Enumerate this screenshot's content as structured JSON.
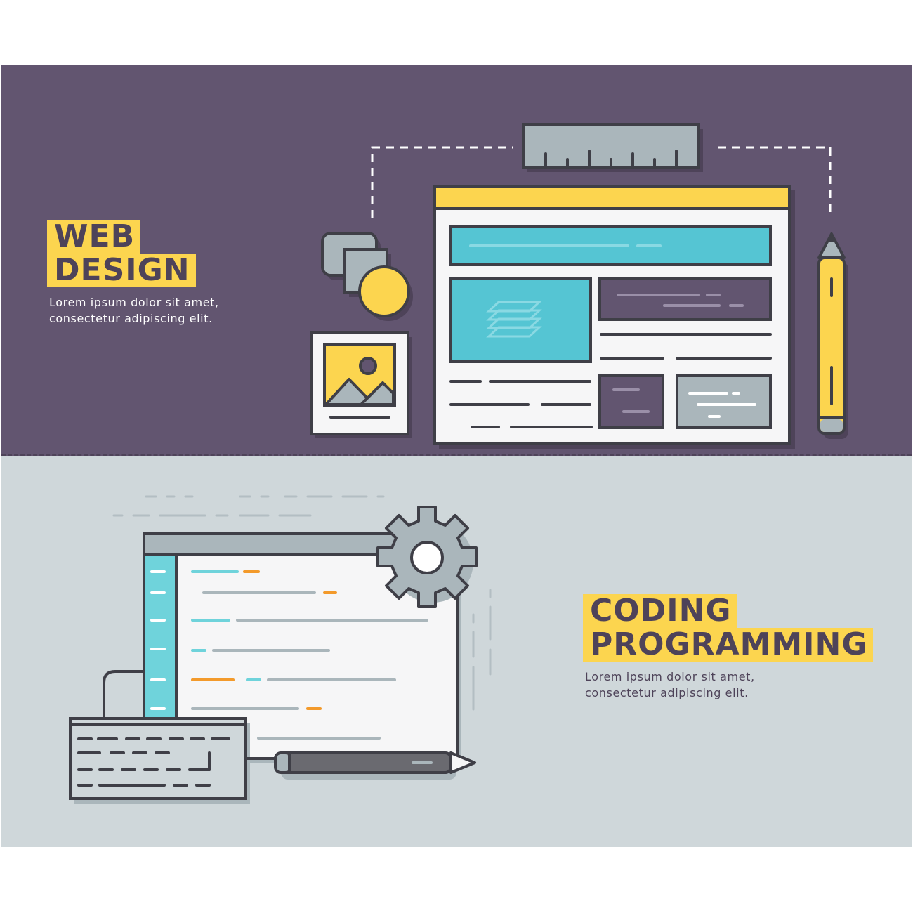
{
  "colors": {
    "purple": "#625570",
    "dark_purple": "#4e4359",
    "yellow": "#fcd54f",
    "teal": "#55c5d3",
    "light_gray": "#cfd7da",
    "mid_gray": "#aab6bb",
    "orange": "#f39a2b",
    "outline": "#3f3f47",
    "white": "#f6f6f7"
  },
  "web_design": {
    "title_line1": "WEB",
    "title_line2": "DESIGN",
    "subtitle_line1": "Lorem ipsum dolor sit amet,",
    "subtitle_line2": "consectetur adipiscing elit.",
    "icons": [
      "ruler-icon",
      "browser-wireframe-icon",
      "shapes-icon",
      "image-icon",
      "pencil-icon",
      "layers-icon"
    ]
  },
  "coding": {
    "title_line1": "CODING",
    "title_line2": "PROGRAMMING",
    "subtitle_line1": "Lorem ipsum dolor sit amet,",
    "subtitle_line2": "consectetur adipiscing elit.",
    "icons": [
      "code-editor-icon",
      "gear-icon",
      "keyboard-icon",
      "pen-icon"
    ]
  }
}
